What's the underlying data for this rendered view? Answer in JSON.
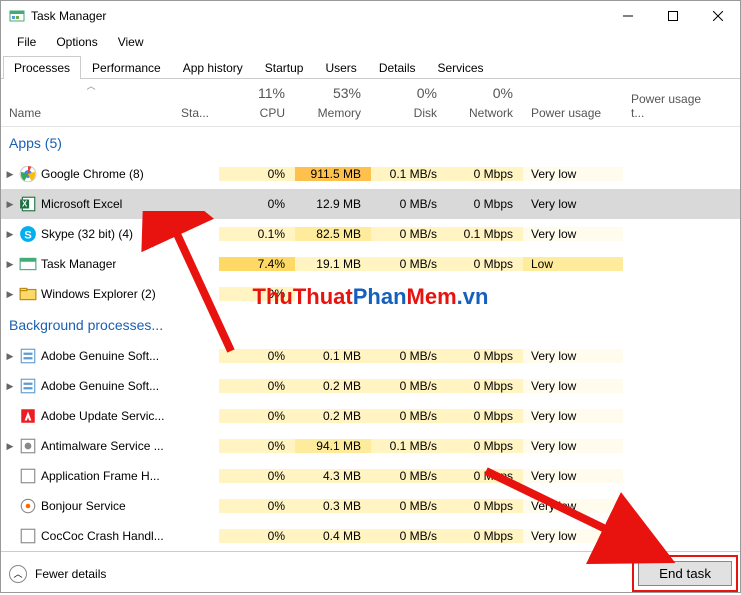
{
  "window": {
    "title": "Task Manager"
  },
  "menu": {
    "file": "File",
    "options": "Options",
    "view": "View"
  },
  "tabs": {
    "processes": "Processes",
    "performance": "Performance",
    "app_history": "App history",
    "startup": "Startup",
    "users": "Users",
    "details": "Details",
    "services": "Services"
  },
  "columns": {
    "name": "Name",
    "status": "Sta...",
    "cpu": {
      "pct": "11%",
      "label": "CPU"
    },
    "memory": {
      "pct": "53%",
      "label": "Memory"
    },
    "disk": {
      "pct": "0%",
      "label": "Disk"
    },
    "network": {
      "pct": "0%",
      "label": "Network"
    },
    "power": "Power usage",
    "powert": "Power usage t..."
  },
  "groups": {
    "apps": "Apps (5)",
    "bg": "Background processes..."
  },
  "rows": {
    "chrome": {
      "name": "Google Chrome (8)",
      "cpu": "0%",
      "mem": "911.5 MB",
      "disk": "0.1 MB/s",
      "net": "0 Mbps",
      "power": "Very low"
    },
    "excel": {
      "name": "Microsoft Excel",
      "cpu": "0%",
      "mem": "12.9 MB",
      "disk": "0 MB/s",
      "net": "0 Mbps",
      "power": "Very low"
    },
    "skype": {
      "name": "Skype (32 bit) (4)",
      "cpu": "0.1%",
      "mem": "82.5 MB",
      "disk": "0 MB/s",
      "net": "0.1 Mbps",
      "power": "Very low"
    },
    "taskmgr": {
      "name": "Task Manager",
      "cpu": "7.4%",
      "mem": "19.1 MB",
      "disk": "0 MB/s",
      "net": "0 Mbps",
      "power": "Low"
    },
    "explorer": {
      "name": "Windows Explorer (2)",
      "cpu": "0%",
      "mem": "",
      "disk": "",
      "net": "",
      "power": ""
    },
    "adobe1": {
      "name": "Adobe Genuine Soft...",
      "cpu": "0%",
      "mem": "0.1 MB",
      "disk": "0 MB/s",
      "net": "0 Mbps",
      "power": "Very low"
    },
    "adobe2": {
      "name": "Adobe Genuine Soft...",
      "cpu": "0%",
      "mem": "0.2 MB",
      "disk": "0 MB/s",
      "net": "0 Mbps",
      "power": "Very low"
    },
    "adobeupd": {
      "name": "Adobe Update Servic...",
      "cpu": "0%",
      "mem": "0.2 MB",
      "disk": "0 MB/s",
      "net": "0 Mbps",
      "power": "Very low"
    },
    "antimal": {
      "name": "Antimalware Service ...",
      "cpu": "0%",
      "mem": "94.1 MB",
      "disk": "0.1 MB/s",
      "net": "0 Mbps",
      "power": "Very low"
    },
    "appframe": {
      "name": "Application Frame H...",
      "cpu": "0%",
      "mem": "4.3 MB",
      "disk": "0 MB/s",
      "net": "0 Mbps",
      "power": "Very low"
    },
    "bonjour": {
      "name": "Bonjour Service",
      "cpu": "0%",
      "mem": "0.3 MB",
      "disk": "0 MB/s",
      "net": "0 Mbps",
      "power": "Very low"
    },
    "coccoc": {
      "name": "CocCoc Crash Handl...",
      "cpu": "0%",
      "mem": "0.4 MB",
      "disk": "0 MB/s",
      "net": "0 Mbps",
      "power": "Very low"
    }
  },
  "footer": {
    "fewer": "Fewer details",
    "end_task": "End task"
  },
  "watermark": {
    "a": "ThuThuat",
    "b": "Phan",
    "c": "Mem",
    "d": ".vn"
  }
}
